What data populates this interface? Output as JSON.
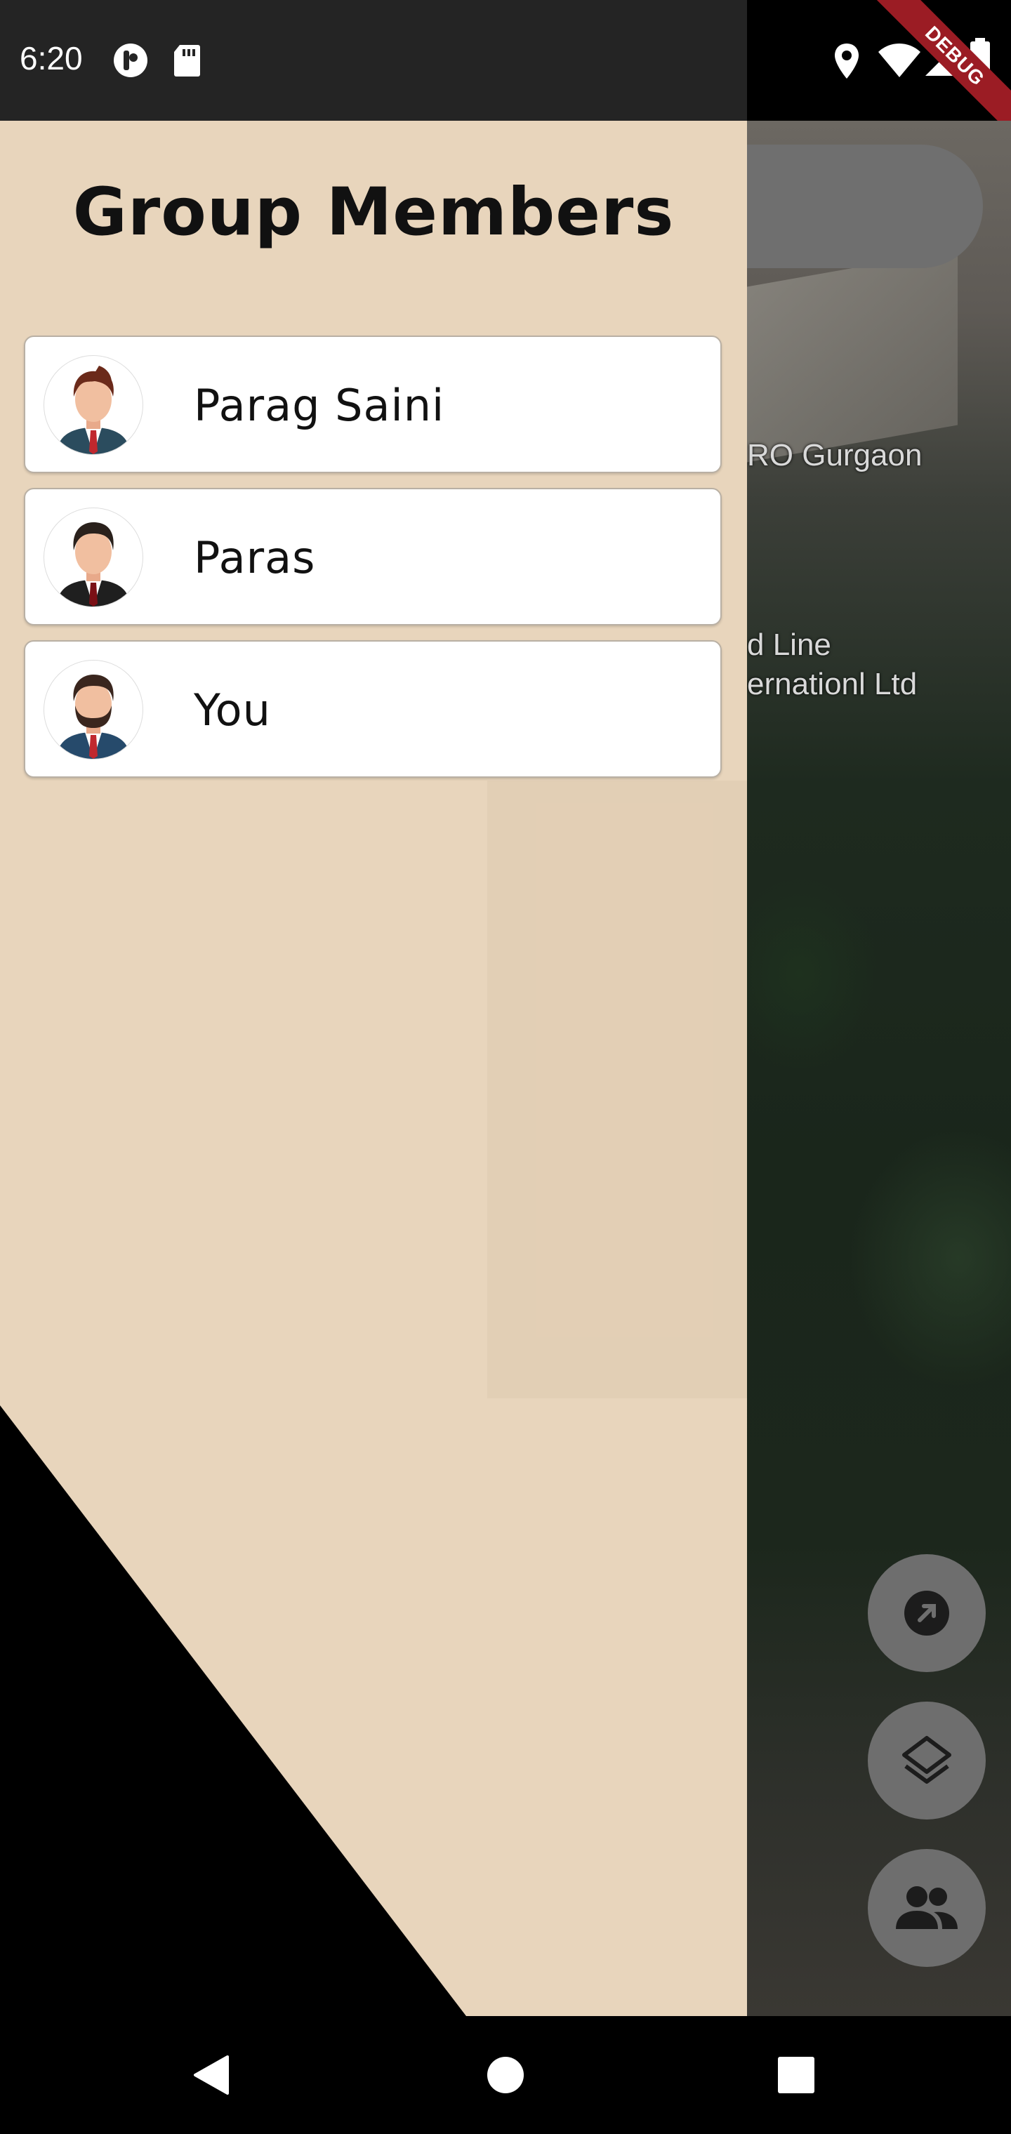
{
  "status_bar": {
    "time": "6:20",
    "icons": [
      "do-not-disturb-icon",
      "sd-card-icon",
      "location-icon",
      "wifi-icon",
      "signal-icon",
      "battery-icon"
    ],
    "debug_label": "DEBUG"
  },
  "map": {
    "labels": [
      "RO Gurgaon",
      "d Line",
      "ernationl Ltd"
    ],
    "fabs": [
      "navigate-icon",
      "layers-icon",
      "group-icon"
    ]
  },
  "drawer": {
    "title": "Group Members",
    "members": [
      {
        "name": "Parag Saini",
        "avatar": "avatar-red-tie"
      },
      {
        "name": "Paras",
        "avatar": "avatar-black-suit"
      },
      {
        "name": "You",
        "avatar": "avatar-beard"
      }
    ]
  },
  "nav_bar": {
    "buttons": [
      "back-icon",
      "home-icon",
      "recents-icon"
    ]
  },
  "colors": {
    "drawer_bg": "#e8d5bc",
    "status_bg": "#242424",
    "fab_bg": "#6e6e6e",
    "debug_ribbon": "#9b1c24"
  }
}
